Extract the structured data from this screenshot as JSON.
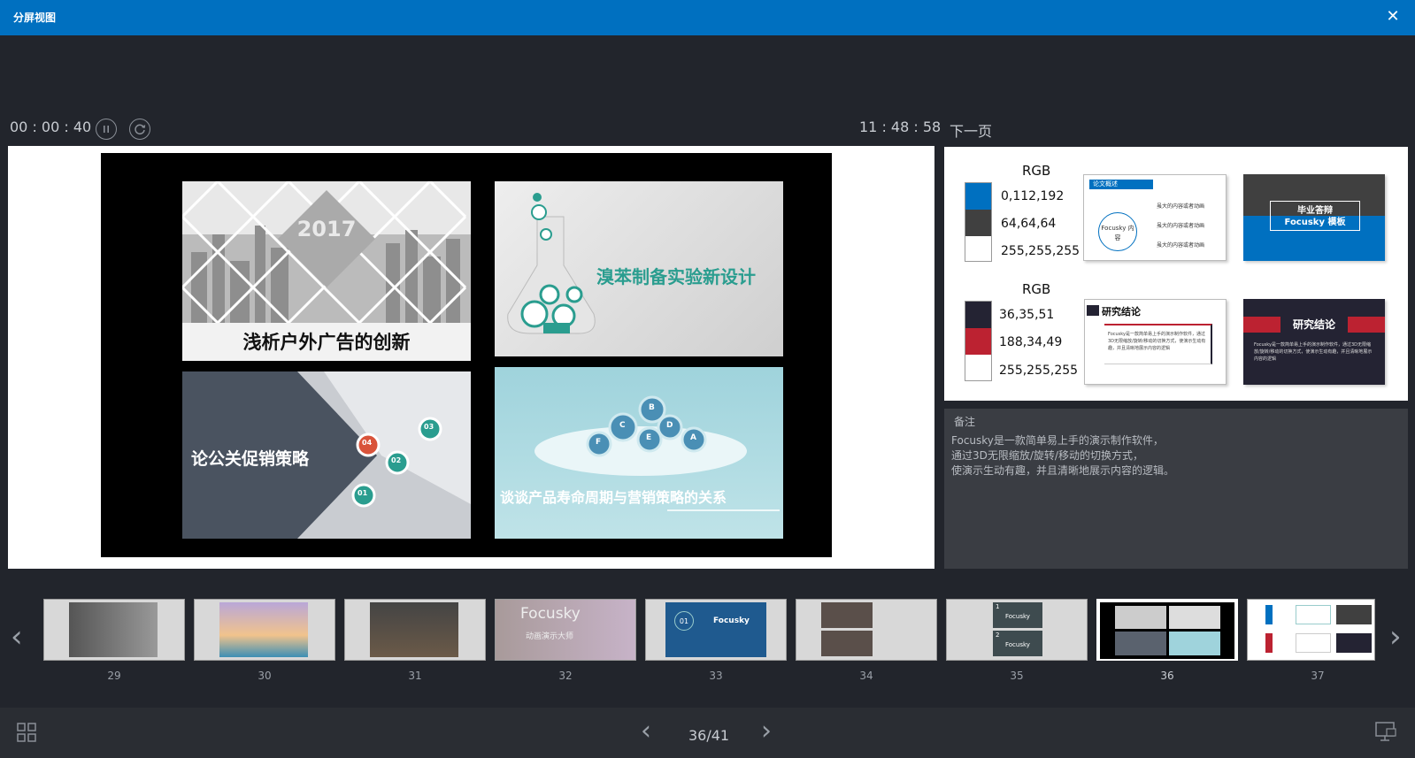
{
  "window": {
    "title": "分屏视图",
    "close_icon": "close-icon"
  },
  "presenter": {
    "elapsed": "00 : 00 : 40",
    "clock": "11 : 48 : 58",
    "next_label": "下一页"
  },
  "current_slide": {
    "tiles": [
      {
        "title": "浅析户外广告的创新",
        "year": "2017"
      },
      {
        "title": "溴苯制备实验新设计"
      },
      {
        "title": "论公关促销策略",
        "badges": [
          "04",
          "03",
          "02",
          "01"
        ]
      },
      {
        "title": "谈谈产品寿命周期与营销策略的关系",
        "gears": [
          "B",
          "C",
          "D",
          "E",
          "F",
          "A"
        ]
      }
    ]
  },
  "next_slide": {
    "rows": [
      {
        "rgb_label": "RGB",
        "values": [
          "0,112,192",
          "64,64,64",
          "255,255,255"
        ],
        "colors": [
          "#0070c0",
          "#404040",
          "#ffffff"
        ],
        "card1_tag": "论文概述",
        "card1_center": "Focusky 内容",
        "card1_items": [
          "虽大的内容或者动画",
          "虽大的内容或者动画",
          "虽大的内容或者动画"
        ],
        "card2_line1": "毕业答辩",
        "card2_line2": "Focusky 模板"
      },
      {
        "rgb_label": "RGB",
        "values": [
          "36,35,51",
          "188,34,49",
          "255,255,255"
        ],
        "colors": [
          "#242333",
          "#bc2231",
          "#ffffff"
        ],
        "card1_title": "研究结论",
        "card1_text": "Focusky是一款简单易上手的演示制作软件，通过3D无限缩放/旋转/移动的切换方式，使演示生动有趣，并且清晰地展示内容的逻辑",
        "card2_title": "研究结论",
        "card2_text": "Focusky是一款简单易上手的演示制作软件，通过3D无限缩放/旋转/移动的切换方式，使演示生动有趣，并且清晰地展示内容的逻辑"
      }
    ]
  },
  "notes": {
    "heading": "备注",
    "lines": [
      "Focusky是一款简单易上手的演示制作软件，",
      "通过3D无限缩放/旋转/移动的切换方式，",
      "使演示生动有趣，并且清晰地展示内容的逻辑。"
    ]
  },
  "thumbnails": [
    {
      "num": "29",
      "text": ""
    },
    {
      "num": "30",
      "text": ""
    },
    {
      "num": "31",
      "text": ""
    },
    {
      "num": "32",
      "text": "Focusky",
      "sub": "动画演示大师"
    },
    {
      "num": "33",
      "text": "Focusky",
      "badge": "01"
    },
    {
      "num": "34",
      "text": ""
    },
    {
      "num": "35",
      "text": "Focusky",
      "marks": [
        "1",
        "2"
      ]
    },
    {
      "num": "36",
      "text": "",
      "selected": true
    },
    {
      "num": "37",
      "text": ""
    }
  ],
  "footer": {
    "page": "36/41"
  },
  "colors": {
    "accent": "#0070c0",
    "bg": "#22252c",
    "panel": "#3a3d43"
  }
}
